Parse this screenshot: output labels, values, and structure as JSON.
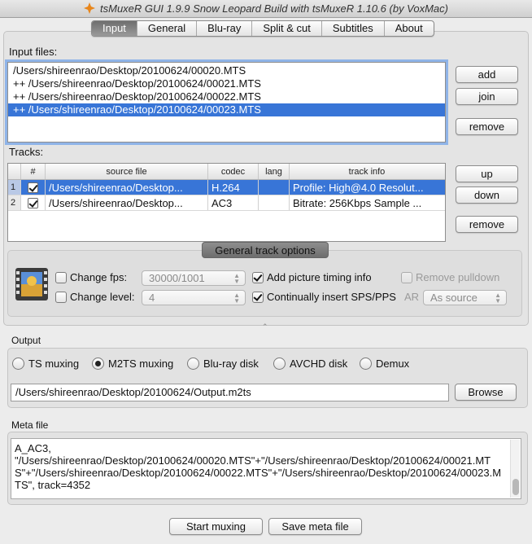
{
  "window": {
    "title": "tsMuxeR GUI 1.9.9 Snow Leopard Build with tsMuxeR 1.10.6 (by VoxMac)"
  },
  "tabs": [
    {
      "label": "Input"
    },
    {
      "label": "General"
    },
    {
      "label": "Blu-ray"
    },
    {
      "label": "Split & cut"
    },
    {
      "label": "Subtitles"
    },
    {
      "label": "About"
    }
  ],
  "input": {
    "label": "Input files:",
    "files": [
      "/Users/shireenrao/Desktop/20100624/00020.MTS",
      " ++ /Users/shireenrao/Desktop/20100624/00021.MTS",
      " ++ /Users/shireenrao/Desktop/20100624/00022.MTS",
      " ++ /Users/shireenrao/Desktop/20100624/00023.MTS"
    ],
    "add_label": "add",
    "join_label": "join",
    "remove_label": "remove"
  },
  "tracks": {
    "label": "Tracks:",
    "columns": [
      "#",
      "source file",
      "codec",
      "lang",
      "track info"
    ],
    "rows": [
      {
        "num": "1",
        "source": "/Users/shireenrao/Desktop...",
        "codec": "H.264",
        "lang": "",
        "info": "Profile: High@4.0  Resolut..."
      },
      {
        "num": "2",
        "source": "/Users/shireenrao/Desktop...",
        "codec": "AC3",
        "lang": "",
        "info": "Bitrate: 256Kbps Sample ..."
      }
    ],
    "up_label": "up",
    "down_label": "down",
    "remove_label": "remove"
  },
  "track_options": {
    "header": "General track options",
    "change_fps_label": "Change fps:",
    "fps_value": "30000/1001",
    "change_level_label": "Change level:",
    "level_value": "4",
    "picture_timing_label": "Add picture timing info",
    "remove_pulldown_label": "Remove pulldown",
    "insert_sps_label": "Continually insert SPS/PPS",
    "ar_label": "AR",
    "ar_value": "As source"
  },
  "output": {
    "label": "Output",
    "options": [
      "TS muxing",
      "M2TS muxing",
      "Blu-ray disk",
      "AVCHD disk",
      "Demux"
    ],
    "selected": "M2TS muxing",
    "path": "/Users/shireenrao/Desktop/20100624/Output.m2ts",
    "browse_label": "Browse"
  },
  "meta": {
    "label": "Meta file",
    "content": "A_AC3,\n\"/Users/shireenrao/Desktop/20100624/00020.MTS\"+\"/Users/shireenrao/Desktop/20100624/00021.MTS\"+\"/Users/shireenrao/Desktop/20100624/00022.MTS\"+\"/Users/shireenrao/Desktop/20100624/00023.MTS\", track=4352"
  },
  "actions": {
    "start_label": "Start muxing",
    "save_label": "Save meta file"
  }
}
